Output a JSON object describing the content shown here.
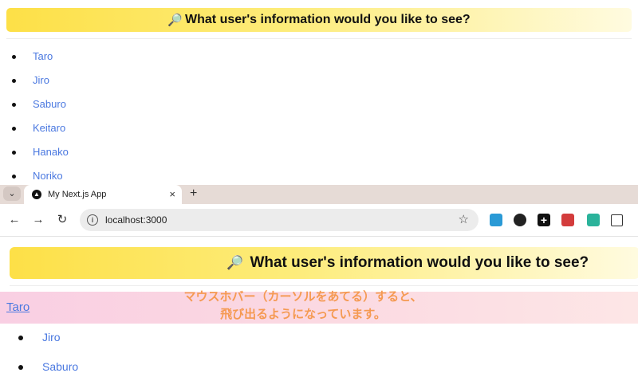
{
  "top": {
    "heading": "What user's information would you like to see?",
    "users": [
      "Taro",
      "Jiro",
      "Saburo",
      "Keitaro",
      "Hanako",
      "Noriko"
    ]
  },
  "browser": {
    "tab_title": "My Next.js App",
    "tab_close": "×",
    "new_tab": "+",
    "url": "localhost:3000",
    "icons": [
      "chevron-down-icon",
      "back-arrow-icon",
      "forward-arrow-icon",
      "reload-icon",
      "info-icon",
      "star-icon",
      "extension-icons",
      "puzzle-icon"
    ]
  },
  "page": {
    "heading": "What user's information would you like to see?",
    "hovered_user": "Taro",
    "users": [
      "Jiro",
      "Saburo"
    ],
    "annotation_line1": "マウスホバー（カーソルをあてる）すると、",
    "annotation_line2": "飛び出るようになっています。",
    "colors": {
      "banner_start": "#fde047",
      "link": "#4a78e0",
      "annotation": "#f59a52",
      "hover_bg": "#f9cfe3"
    }
  }
}
